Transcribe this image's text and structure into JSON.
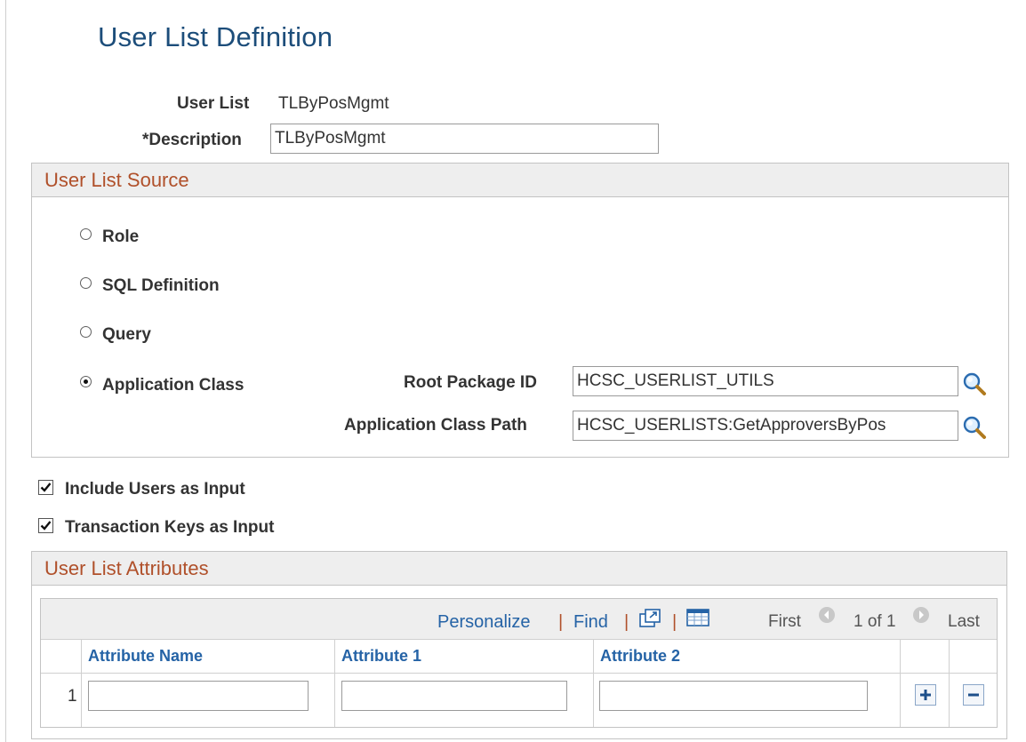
{
  "page": {
    "title": "User List Definition"
  },
  "header_fields": {
    "user_list_label": "User List",
    "user_list_value": "TLByPosMgmt",
    "description_label": "*Description",
    "description_value": "TLByPosMgmt"
  },
  "source": {
    "title": "User List Source",
    "options": [
      {
        "label": "Role",
        "selected": false
      },
      {
        "label": "SQL Definition",
        "selected": false
      },
      {
        "label": "Query",
        "selected": false
      },
      {
        "label": "Application Class",
        "selected": true
      }
    ],
    "root_package_label": "Root Package ID",
    "root_package_value": "HCSC_USERLIST_UTILS",
    "class_path_label": "Application Class Path",
    "class_path_value": "HCSC_USERLISTS:GetApproversByPos"
  },
  "checkboxes": {
    "include_users_label": "Include Users as Input",
    "include_users_checked": true,
    "transaction_keys_label": "Transaction Keys as Input",
    "transaction_keys_checked": true
  },
  "attributes": {
    "title": "User List Attributes",
    "toolbar": {
      "personalize": "Personalize",
      "separator": "|",
      "find": "Find",
      "first": "First",
      "range": "1 of 1",
      "last": "Last"
    },
    "columns": [
      "Attribute Name",
      "Attribute 1",
      "Attribute 2"
    ],
    "rows": [
      {
        "index": "1",
        "name": "",
        "attr1": "",
        "attr2": ""
      }
    ]
  },
  "colors": {
    "title": "#1c4d7a",
    "group_title": "#b0502a",
    "link": "#2563a6",
    "header_bg": "#eeeeee"
  }
}
